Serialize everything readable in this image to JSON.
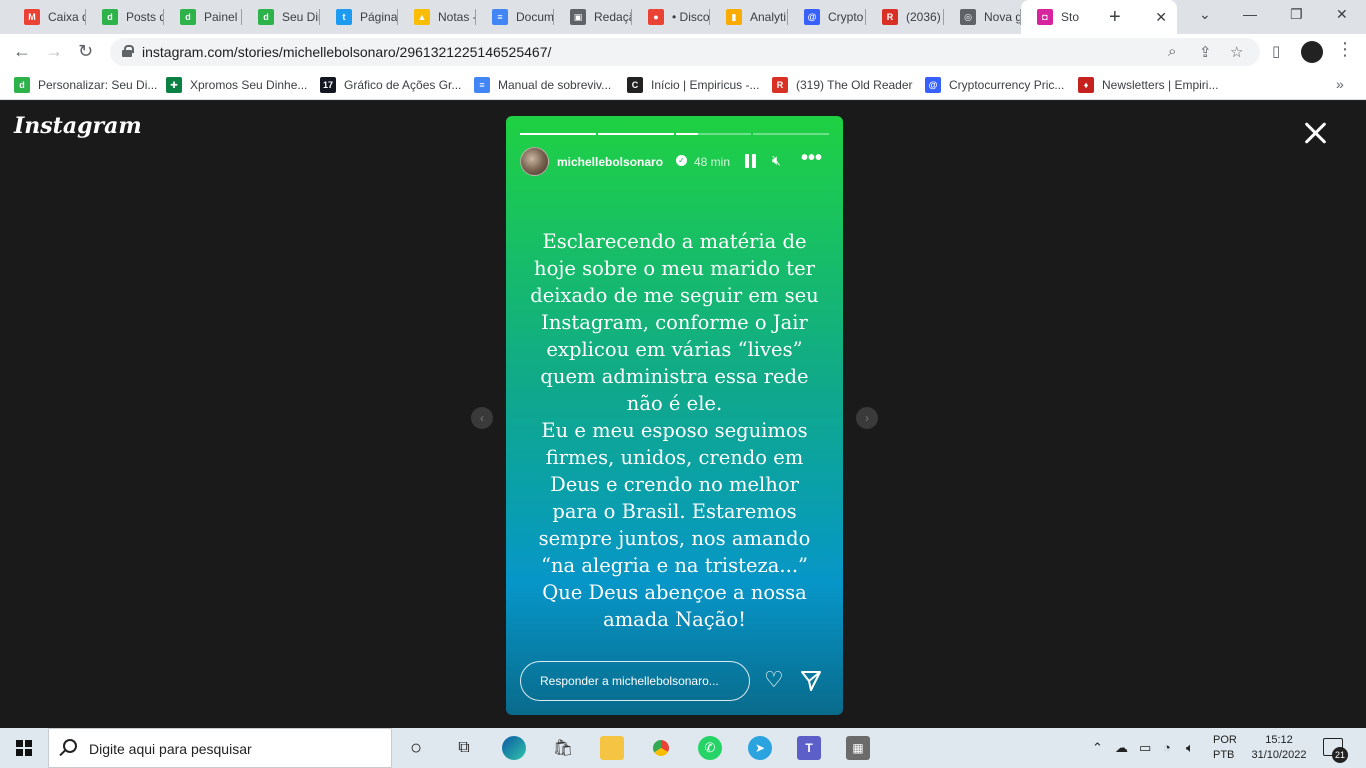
{
  "browser": {
    "tabs": [
      {
        "label": "Caixa d",
        "icon": "gmail-icon",
        "color": "#ea4335",
        "glyph": "M"
      },
      {
        "label": "Posts d",
        "icon": "seudinheiro-icon",
        "color": "#2db34a",
        "glyph": "d"
      },
      {
        "label": "Painel d",
        "icon": "seudinheiro-icon",
        "color": "#2db34a",
        "glyph": "d"
      },
      {
        "label": "Seu Din",
        "icon": "seudinheiro-icon",
        "color": "#2db34a",
        "glyph": "d"
      },
      {
        "label": "Página",
        "icon": "twitter-icon",
        "color": "#1d9bf0",
        "glyph": "t"
      },
      {
        "label": "Notas -",
        "icon": "drive-icon",
        "color": "#fbbc04",
        "glyph": "▲"
      },
      {
        "label": "Docum",
        "icon": "docs-icon",
        "color": "#4285f4",
        "glyph": "≡"
      },
      {
        "label": "Redaçã",
        "icon": "document-icon",
        "color": "#5f6368",
        "glyph": "▣"
      },
      {
        "label": "• Disco",
        "icon": "chrome-remote-icon",
        "color": "#ea4335",
        "glyph": "●"
      },
      {
        "label": "Analyti",
        "icon": "analytics-icon",
        "color": "#f9ab00",
        "glyph": "▮"
      },
      {
        "label": "Crypto",
        "icon": "coinmarketcap-icon",
        "color": "#3861fb",
        "glyph": "@"
      },
      {
        "label": "(2036)",
        "icon": "oldreader-icon",
        "color": "#d93025",
        "glyph": "R"
      },
      {
        "label": "Nova g",
        "icon": "chrome-icon",
        "color": "#5f6368",
        "glyph": "◎"
      },
      {
        "label": "Sto",
        "icon": "instagram-icon",
        "color": "#d6249f",
        "glyph": "◘"
      }
    ],
    "new_tab": "+",
    "window_controls": {
      "minimize": "—",
      "restore": "❐",
      "close": "✕",
      "tabsearch": "⌄"
    },
    "url": "instagram.com/stories/michellebolsonaro/2961321225146525467/",
    "bookmarks": [
      {
        "label": "Personalizar: Seu Di...",
        "icon": "seudinheiro-icon",
        "color": "#2db34a",
        "glyph": "d"
      },
      {
        "label": "Xpromos Seu Dinhe...",
        "icon": "cross-icon",
        "color": "#0b8043",
        "glyph": "✚"
      },
      {
        "label": "Gráfico de Ações Gr...",
        "icon": "tradingview-icon",
        "color": "#131722",
        "glyph": "17"
      },
      {
        "label": "Manual de sobreviv...",
        "icon": "docs-icon",
        "color": "#4285f4",
        "glyph": "≡"
      },
      {
        "label": "Início | Empiricus -...",
        "icon": "empiricus-icon",
        "color": "#222222",
        "glyph": "C"
      },
      {
        "label": "(319) The Old Reader",
        "icon": "oldreader-icon",
        "color": "#d93025",
        "glyph": "R"
      },
      {
        "label": "Cryptocurrency Pric...",
        "icon": "coinmarketcap-icon",
        "color": "#3861fb",
        "glyph": "@"
      },
      {
        "label": "Newsletters | Empiri...",
        "icon": "empiricus-drop-icon",
        "color": "#c5221f",
        "glyph": "♦"
      }
    ],
    "bookmarks_more": "»"
  },
  "instagram": {
    "logo": "Instagram",
    "story": {
      "progress": [
        1,
        1,
        0.3,
        0
      ],
      "username": "michellebolsonaro",
      "time": "48 min",
      "text": "Esclarecendo a matéria de\nhoje sobre o meu marido ter\ndeixado de me seguir em seu\nInstagram, conforme o Jair\nexplicou em várias “lives”\nquem administra essa rede\nnão é ele.\nEu e meu esposo seguimos\nfirmes, unidos, crendo em\nDeus e crendo no melhor\npara o Brasil. Estaremos\nsempre juntos, nos amando\n“na alegria e na tristeza...”\nQue Deus abençoe a nossa\namada Nação!",
      "reply_placeholder": "Responder a michellebolsonaro..."
    }
  },
  "taskbar": {
    "search_placeholder": "Digite aqui para pesquisar",
    "language_top": "POR",
    "language_bottom": "PTB",
    "time": "15:12",
    "date": "31/10/2022",
    "notification_count": "21"
  }
}
